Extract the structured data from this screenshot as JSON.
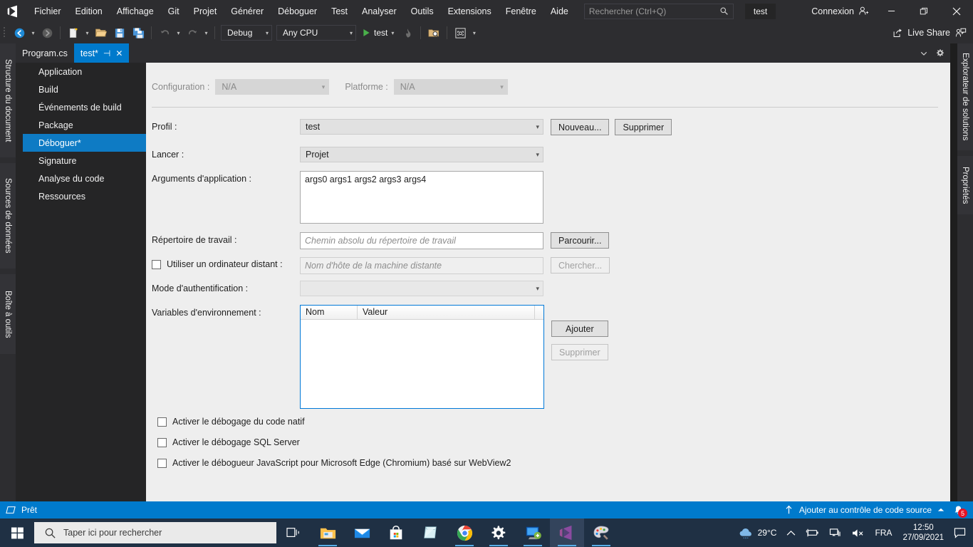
{
  "titlebar": {
    "logo_icon": "visual-studio-logo",
    "menus": [
      "Fichier",
      "Edition",
      "Affichage",
      "Git",
      "Projet",
      "Générer",
      "Déboguer",
      "Test",
      "Analyser",
      "Outils",
      "Extensions",
      "Fenêtre",
      "Aide"
    ],
    "search_placeholder": "Rechercher (Ctrl+Q)",
    "search_icon": "search-icon",
    "project_chip": "test",
    "signin_label": "Connexion",
    "signin_icon": "account-add-icon",
    "minimize_icon": "minimize-icon",
    "restore_icon": "restore-icon",
    "close_icon": "close-icon"
  },
  "toolbar": {
    "nav_back_icon": "navigate-back-icon",
    "nav_forward_icon": "navigate-forward-icon",
    "new_project_icon": "new-project-icon",
    "open_icon": "open-folder-icon",
    "save_icon": "save-icon",
    "save_all_icon": "save-all-icon",
    "undo_icon": "undo-icon",
    "redo_icon": "redo-icon",
    "configuration": "Debug",
    "platform": "Any CPU",
    "run_label": "test",
    "run_icon": "play-icon",
    "hot_reload_icon": "hot-reload-icon",
    "select_icon": "select-element-icon",
    "screenshot_icon": "screenshot-icon",
    "live_share_label": "Live Share",
    "live_share_icon": "live-share-icon",
    "live_share_pin_icon": "live-share-session-icon"
  },
  "left_tabs": [
    "Structure du document",
    "Sources de données",
    "Boîte à outils"
  ],
  "right_tabs": [
    "Explorateur de solutions",
    "Propriétés"
  ],
  "document_tabs": [
    {
      "label": "Program.cs",
      "active": false
    },
    {
      "label": "test*",
      "active": true,
      "pin_icon": "pin-icon",
      "close_icon": "close-icon"
    }
  ],
  "tabbar_actions": {
    "dropdown_icon": "chevron-down-icon",
    "settings_icon": "gear-icon"
  },
  "nav_pane": {
    "items": [
      {
        "label": "Application",
        "selected": false
      },
      {
        "label": "Build",
        "selected": false
      },
      {
        "label": "Événements de build",
        "selected": false
      },
      {
        "label": "Package",
        "selected": false
      },
      {
        "label": "Déboguer*",
        "selected": true
      },
      {
        "label": "Signature",
        "selected": false
      },
      {
        "label": "Analyse du code",
        "selected": false
      },
      {
        "label": "Ressources",
        "selected": false
      }
    ]
  },
  "content": {
    "configuration_label": "Configuration :",
    "configuration_value": "N/A",
    "platform_label": "Platforme :",
    "platform_value": "N/A",
    "profile_label": "Profil :",
    "profile_value": "test",
    "new_button": "Nouveau...",
    "delete_button": "Supprimer",
    "launch_label": "Lancer :",
    "launch_value": "Projet",
    "app_args_label": "Arguments d'application :",
    "app_args_value": "args0 args1 args2 args3 args4",
    "working_dir_label": "Répertoire de travail :",
    "working_dir_placeholder": "Chemin absolu du répertoire de travail",
    "browse_button": "Parcourir...",
    "remote_machine_label": "Utiliser un ordinateur distant :",
    "remote_machine_placeholder": "Nom d'hôte de la machine distante",
    "search_button": "Chercher...",
    "auth_mode_label": "Mode d'authentification :",
    "auth_mode_value": "",
    "env_vars_label": "Variables d'environnement :",
    "env_col_name": "Nom",
    "env_col_value": "Valeur",
    "env_rows": [],
    "add_button": "Ajouter",
    "remove_button": "Supprimer",
    "checkbox_native": "Activer le débogage du code natif",
    "checkbox_sql": "Activer le débogage SQL Server",
    "checkbox_js": "Activer le débogueur JavaScript pour Microsoft Edge (Chromium) basé sur WebView2",
    "accent_color": "#0078d7"
  },
  "statusbar": {
    "ready_label": "Prêt",
    "ready_icon": "ready-icon",
    "source_control_label": "Ajouter au contrôle de code source",
    "source_control_up_icon": "arrow-up-icon",
    "source_control_caret_icon": "caret-up-icon",
    "notification_icon": "bell-icon",
    "notification_count": "5",
    "background": "#007acc"
  },
  "taskbar": {
    "start_icon": "windows-start-icon",
    "search_placeholder": "Taper ici pour rechercher",
    "search_icon": "search-icon",
    "taskview_icon": "task-view-icon",
    "apps": [
      {
        "name": "file-explorer-icon"
      },
      {
        "name": "mail-icon"
      },
      {
        "name": "microsoft-store-icon"
      },
      {
        "name": "sticky-notes-icon"
      },
      {
        "name": "google-chrome-icon"
      },
      {
        "name": "settings-icon"
      },
      {
        "name": "remote-desktop-icon"
      },
      {
        "name": "visual-studio-icon"
      },
      {
        "name": "paint-icon"
      }
    ],
    "weather_temp": "29°C",
    "weather_icon": "cloud-icon",
    "tray_chevron_icon": "chevron-up-icon",
    "battery_icon": "battery-icon",
    "network_icon": "network-icon",
    "volume_icon": "volume-muted-icon",
    "language": "FRA",
    "time": "12:50",
    "date": "27/09/2021",
    "action_center_icon": "action-center-icon"
  }
}
